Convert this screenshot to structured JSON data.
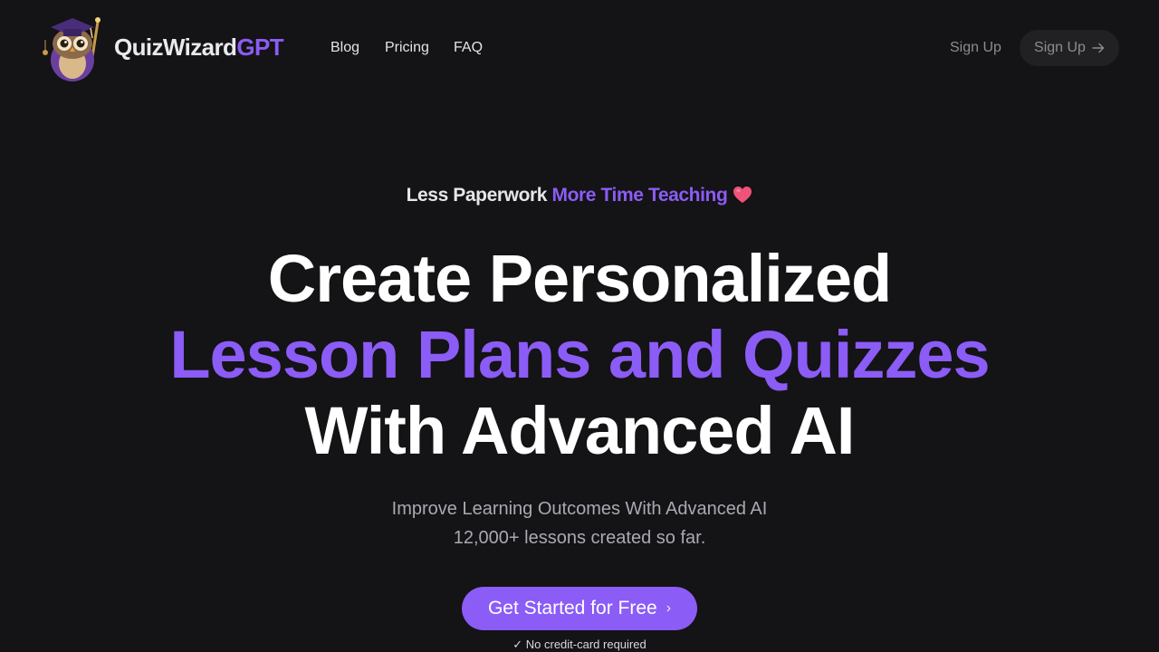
{
  "header": {
    "brand_part1": "QuizWizard",
    "brand_part2": "GPT",
    "nav": [
      {
        "label": "Blog"
      },
      {
        "label": "Pricing"
      },
      {
        "label": "FAQ"
      }
    ],
    "signup_link": "Sign Up",
    "signup_button": "Sign Up",
    "signup_button_icon": "arrow-right-icon",
    "logo_icon": "owl-wizard-mascot-icon"
  },
  "hero": {
    "tagline_part1": "Less Paperwork",
    "tagline_part2": "More Time Teaching",
    "tagline_icon": "heart-icon",
    "headline_line1": "Create Personalized",
    "headline_line2": "Lesson Plans and Quizzes",
    "headline_line3": "With Advanced AI",
    "subtitle_line1": "Improve Learning Outcomes With Advanced AI",
    "subtitle_line2": "12,000+ lessons created so far.",
    "cta_label": "Get Started for Free",
    "cta_chevron": "›",
    "note": "✓ No credit-card required"
  },
  "colors": {
    "background": "#141315",
    "accent": "#8b5cf6",
    "button_dark": "#212123",
    "muted_text": "#8c8c92",
    "heart": "#f0527a"
  }
}
